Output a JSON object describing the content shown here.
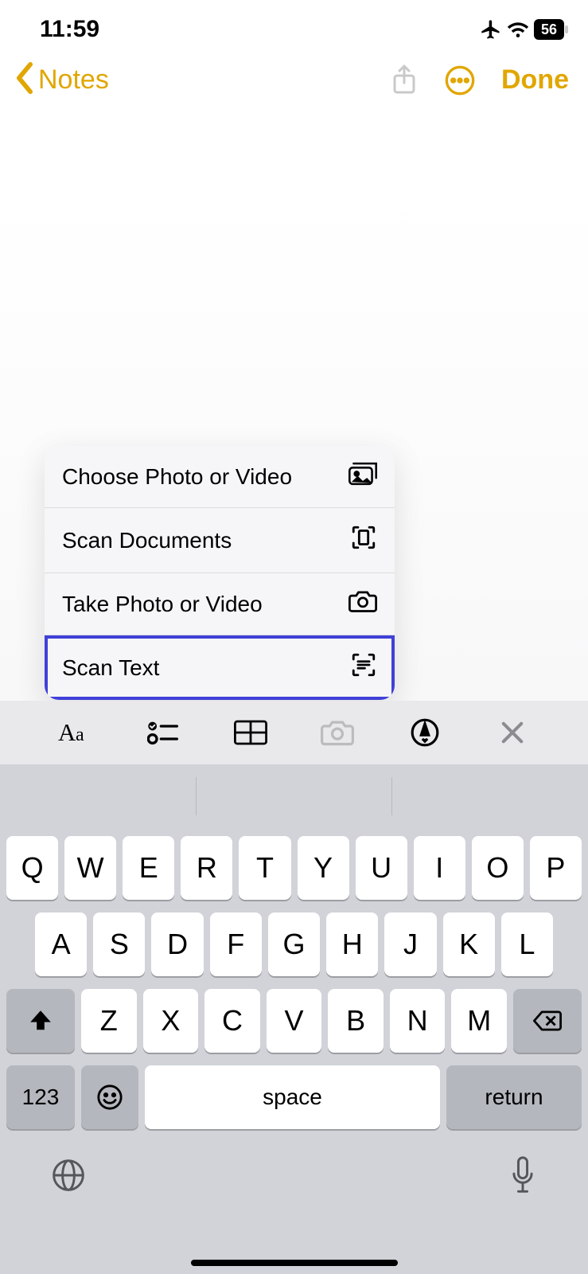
{
  "status": {
    "time": "11:59",
    "battery": "56"
  },
  "nav": {
    "back_label": "Notes",
    "done_label": "Done"
  },
  "popup": {
    "items": [
      {
        "label": "Choose Photo or Video"
      },
      {
        "label": "Scan Documents"
      },
      {
        "label": "Take Photo or Video"
      },
      {
        "label": "Scan Text"
      }
    ]
  },
  "keyboard": {
    "row1": [
      "Q",
      "W",
      "E",
      "R",
      "T",
      "Y",
      "U",
      "I",
      "O",
      "P"
    ],
    "row2": [
      "A",
      "S",
      "D",
      "F",
      "G",
      "H",
      "J",
      "K",
      "L"
    ],
    "row3": [
      "Z",
      "X",
      "C",
      "V",
      "B",
      "N",
      "M"
    ],
    "numbers_label": "123",
    "space_label": "space",
    "return_label": "return"
  }
}
